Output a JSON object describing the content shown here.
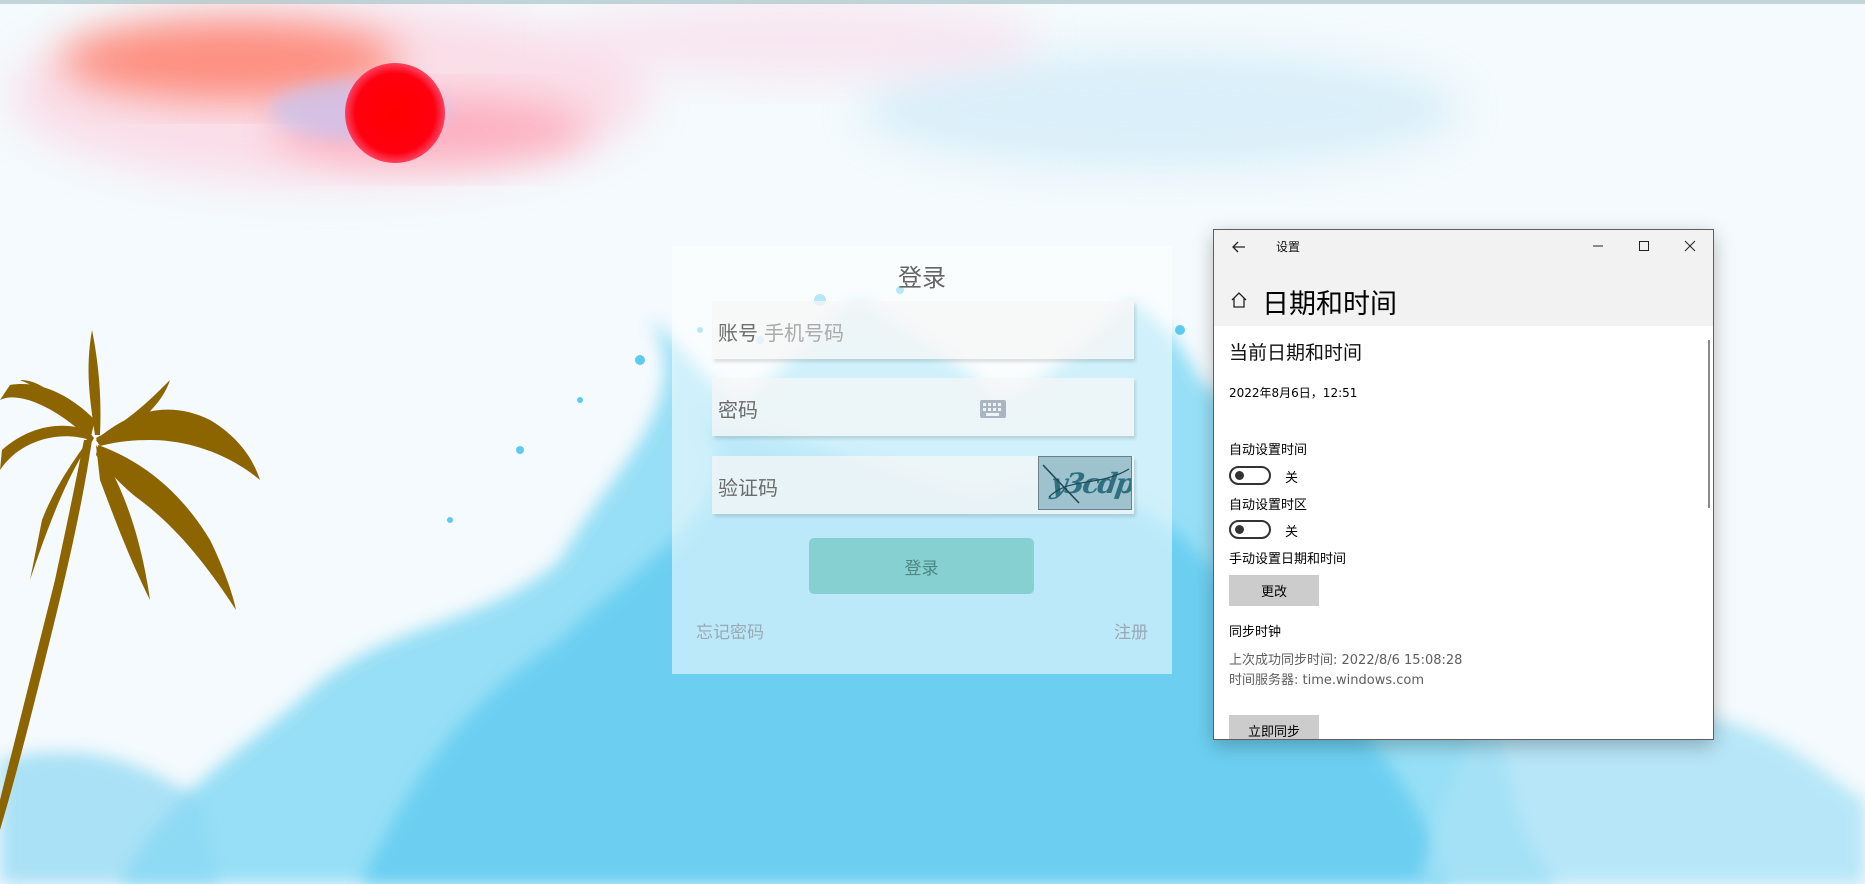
{
  "login": {
    "title": "登录",
    "account_label": "账号",
    "account_placeholder": "手机号码",
    "password_label": "密码",
    "captcha_label": "验证码",
    "captcha_text": "y3cdp",
    "submit_label": "登录",
    "forgot_label": "忘记密码",
    "register_label": "注册"
  },
  "settings": {
    "window_title": "设置",
    "page_title": "日期和时间",
    "section_title": "当前日期和时间",
    "current_datetime": "2022年8月6日，12:51",
    "auto_time_label": "自动设置时间",
    "auto_time_state": "关",
    "auto_zone_label": "自动设置时区",
    "auto_zone_state": "关",
    "manual_label": "手动设置日期和时间",
    "change_button": "更改",
    "sync_title": "同步时钟",
    "last_sync": "上次成功同步时间: 2022/8/6 15:08:28",
    "time_server": "时间服务器: time.windows.com",
    "sync_button": "立即同步"
  },
  "icons": {
    "back": "arrow-left-icon",
    "minimize": "minimize-icon",
    "maximize": "maximize-icon",
    "close": "close-icon",
    "home": "home-icon",
    "keyboard": "keyboard-icon"
  },
  "colors": {
    "login_button": "#80cdcd",
    "sun": "#ff0000",
    "splash": "#5ccdf2",
    "palm": "#8c6400",
    "win_button": "#cccccc"
  }
}
